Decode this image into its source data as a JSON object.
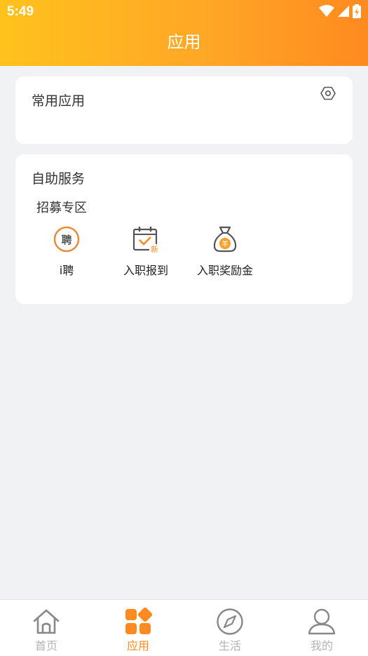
{
  "status_bar": {
    "time": "5:49"
  },
  "header": {
    "title": "应用"
  },
  "common_apps": {
    "title": "常用应用"
  },
  "self_service": {
    "title": "自助服务",
    "section": "招募专区",
    "items": [
      {
        "label": "i聘",
        "icon": "recruit-icon"
      },
      {
        "label": "入职报到",
        "icon": "calendar-check-icon"
      },
      {
        "label": "入职奖励金",
        "icon": "money-bag-icon"
      }
    ]
  },
  "icon_glyphs": {
    "recruit": "聘",
    "calendar_badge": "新",
    "money": "羊"
  },
  "tabbar": {
    "items": [
      {
        "label": "首页",
        "icon": "home-icon"
      },
      {
        "label": "应用",
        "icon": "apps-icon",
        "active": true
      },
      {
        "label": "生活",
        "icon": "compass-icon"
      },
      {
        "label": "我的",
        "icon": "user-icon"
      }
    ]
  },
  "colors": {
    "accent": "#ff8a1f",
    "header_start": "#ffc21c",
    "header_end": "#ff8a1f",
    "inactive": "#b4b4b4",
    "background": "#f1f2f4"
  }
}
